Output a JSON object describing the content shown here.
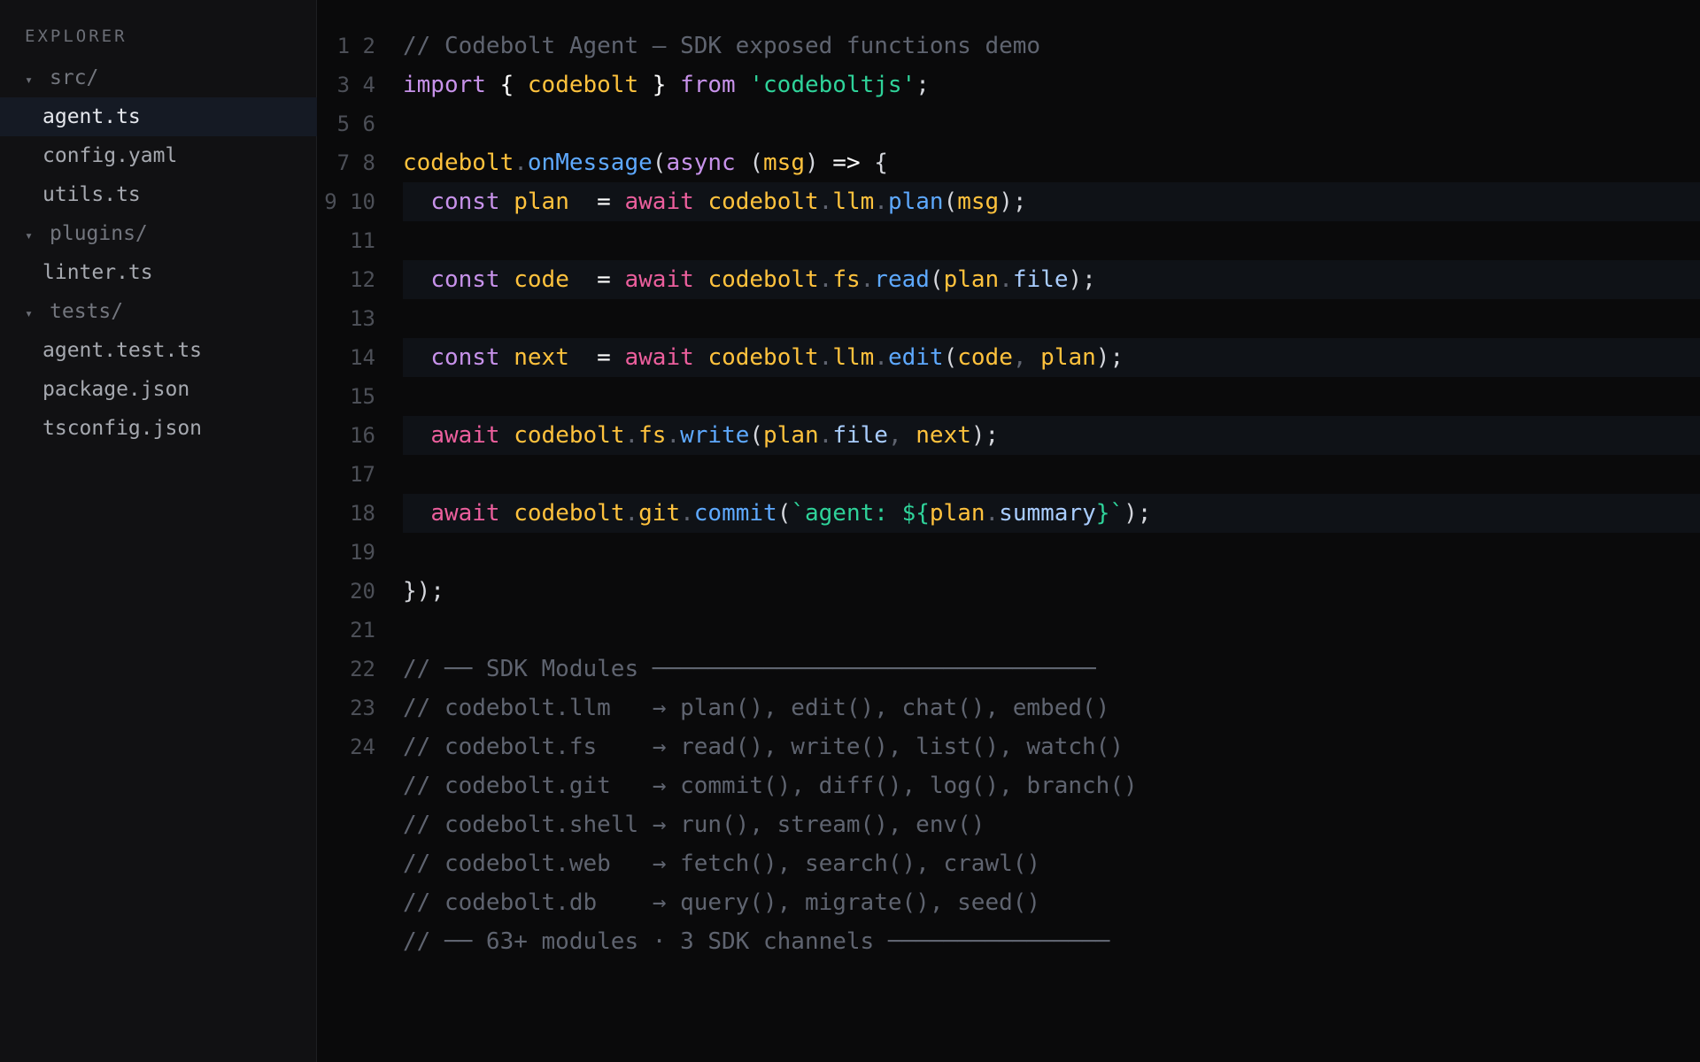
{
  "sidebar": {
    "title": "EXPLORER",
    "items": [
      {
        "label": "src/",
        "kind": "folder",
        "expanded": true
      },
      {
        "label": "agent.ts",
        "kind": "file",
        "active": true
      },
      {
        "label": "config.yaml",
        "kind": "file"
      },
      {
        "label": "utils.ts",
        "kind": "file"
      },
      {
        "label": "plugins/",
        "kind": "folder",
        "expanded": true
      },
      {
        "label": "linter.ts",
        "kind": "file"
      },
      {
        "label": "tests/",
        "kind": "folder",
        "expanded": true
      },
      {
        "label": "agent.test.ts",
        "kind": "file"
      },
      {
        "label": "package.json",
        "kind": "file"
      },
      {
        "label": "tsconfig.json",
        "kind": "file"
      }
    ],
    "chevron_glyph": "▾",
    "chevron_icon": "chevron-down-icon"
  },
  "editor": {
    "gutter": [
      "1 2",
      "3 4",
      "5 6",
      "7 8",
      "9 10",
      "11",
      "12",
      "13",
      "14",
      "15",
      "16",
      "17",
      "18",
      "19",
      "20",
      "21",
      "22",
      "23",
      "24"
    ],
    "code": {
      "header_comment": "// Codebolt Agent — SDK exposed functions demo",
      "import_kw": "import",
      "import_open": " { ",
      "import_name": "codebolt",
      "import_close": " } ",
      "from_kw": "from",
      "module_str": "'codeboltjs'",
      "semi": ";",
      "l3": {
        "obj": "codebolt",
        "dot": ".",
        "fn": "onMessage",
        "open": "(",
        "async": "async",
        "p_open": " (",
        "arg": "msg",
        "p_close": ")",
        "arrow": " => ",
        "brace": "{"
      },
      "l4": {
        "kw": "const",
        "name": "plan",
        "eq": "  = ",
        "await": "await",
        "obj": "codebolt",
        "mod": "llm",
        "fn": "plan",
        "arg": "msg",
        "end": ");"
      },
      "l5": {
        "kw": "const",
        "name": "code",
        "eq": "  = ",
        "await": "await",
        "obj": "codebolt",
        "mod": "fs",
        "fn": "read",
        "arg": "plan",
        "prop": "file",
        "end": ");"
      },
      "l6": {
        "kw": "const",
        "name": "next",
        "eq": "  = ",
        "await": "await",
        "obj": "codebolt",
        "mod": "llm",
        "fn": "edit",
        "arg1": "code",
        "comma": ", ",
        "arg2": "plan",
        "end": ");"
      },
      "l7": {
        "await": "await",
        "obj": "codebolt",
        "mod": "fs",
        "fn": "write",
        "arg": "plan",
        "prop": "file",
        "comma": ", ",
        "arg2": "next",
        "end": ");"
      },
      "l8": {
        "await": "await",
        "obj": "codebolt",
        "mod": "git",
        "fn": "commit",
        "tpl_start": "`agent: ${",
        "arg": "plan",
        "prop": "summary",
        "tpl_end": "}`",
        "end": ");"
      },
      "close": "});",
      "modules_header": "// ── SDK Modules ────────────────────────────────",
      "module_lines": [
        "// codebolt.llm   → plan(), edit(), chat(), embed()",
        "// codebolt.fs    → read(), write(), list(), watch()",
        "// codebolt.git   → commit(), diff(), log(), branch()",
        "// codebolt.shell → run(), stream(), env()",
        "// codebolt.web   → fetch(), search(), crawl()",
        "// codebolt.db    → query(), migrate(), seed()"
      ],
      "footer_comment": "// ── 63+ modules · 3 SDK channels ────────────────"
    }
  }
}
